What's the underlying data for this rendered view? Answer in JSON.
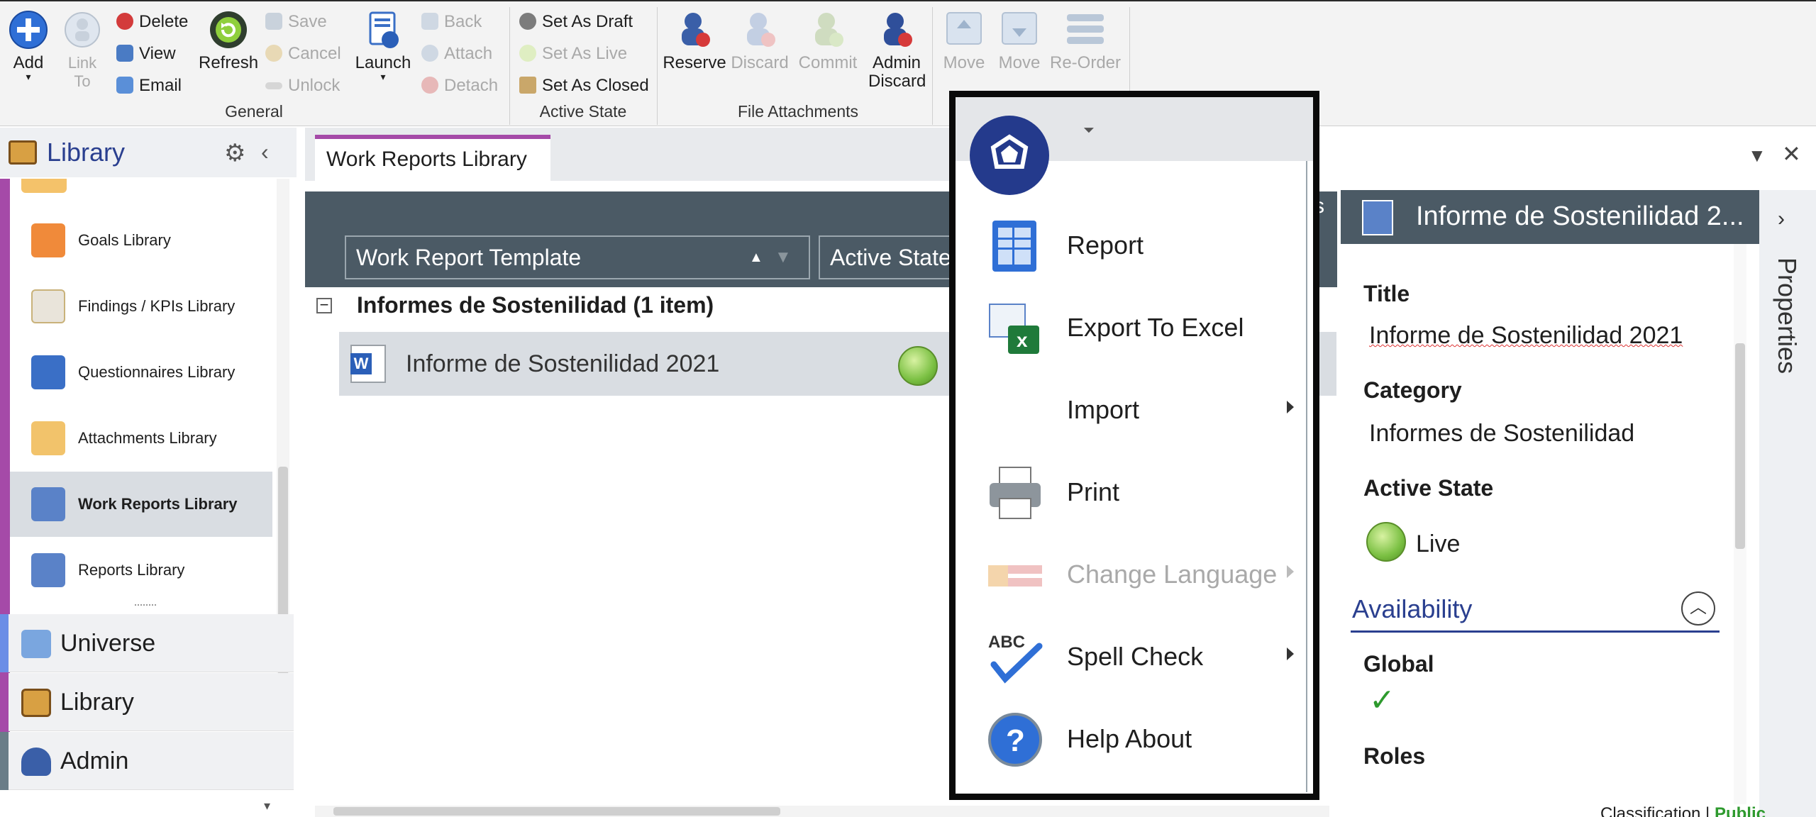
{
  "ribbon": {
    "add_label": "Add",
    "link_to_label": "Link To",
    "delete_label": "Delete",
    "view_label": "View",
    "email_label": "Email",
    "refresh_label": "Refresh",
    "save_label": "Save",
    "cancel_label": "Cancel",
    "unlock_label": "Unlock",
    "launch_label": "Launch",
    "back_label": "Back",
    "attach_label": "Attach",
    "detach_label": "Detach",
    "set_draft_label": "Set As Draft",
    "set_live_label": "Set As Live",
    "set_closed_label": "Set As Closed",
    "reserve_label": "Reserve",
    "discard_label": "Discard",
    "commit_label": "Commit",
    "admin_discard_label": "Admin Discard",
    "move_up_label": "Move Up",
    "move_down_label": "Move Down",
    "reorder_label": "Re-Order",
    "groups": [
      "General",
      "Active State",
      "File Attachments"
    ]
  },
  "sidebar": {
    "title": "Library",
    "libraries": [
      {
        "label": "Goals Library"
      },
      {
        "label": "Findings / KPIs Library"
      },
      {
        "label": "Questionnaires Library"
      },
      {
        "label": "Attachments Library"
      },
      {
        "label": "Work Reports Library"
      },
      {
        "label": "Reports Library"
      }
    ],
    "nav": [
      {
        "label": "Universe",
        "color": "#6b8ee6"
      },
      {
        "label": "Library",
        "color": "#a54aa8"
      },
      {
        "label": "Admin",
        "color": "#6a7d88"
      }
    ]
  },
  "center": {
    "tab_label": "Work Reports Library",
    "col_template": "Work Report Template",
    "col_active_state": "Active State",
    "group_label": "Informes de Sostenilidad (1 item)",
    "row_name": "Informe de Sostenilidad 2021",
    "partial_header_char": "s"
  },
  "menu": {
    "items": [
      {
        "label": "Report"
      },
      {
        "label": "Export To Excel"
      },
      {
        "label": "Import"
      },
      {
        "label": "Print"
      },
      {
        "label": "Change Language"
      },
      {
        "label": "Spell Check"
      },
      {
        "label": "Help About"
      }
    ]
  },
  "properties": {
    "header_title": "Informe de Sostenilidad 2...",
    "side_tab": "Properties",
    "title_label": "Title",
    "title_value": "Informe de Sostenilidad 2021",
    "category_label": "Category",
    "category_value": "Informes de Sostenilidad",
    "active_state_label": "Active State",
    "active_state_value": "Live",
    "availability_label": "Availability",
    "global_label": "Global",
    "roles_label": "Roles",
    "classification_label": "Classification |",
    "classification_value": "Public"
  },
  "colors": {
    "accent": "#2a3f8f",
    "tab_accent": "#a54aa8",
    "live_green": "#7bc043",
    "check_green": "#2e9a2e"
  }
}
